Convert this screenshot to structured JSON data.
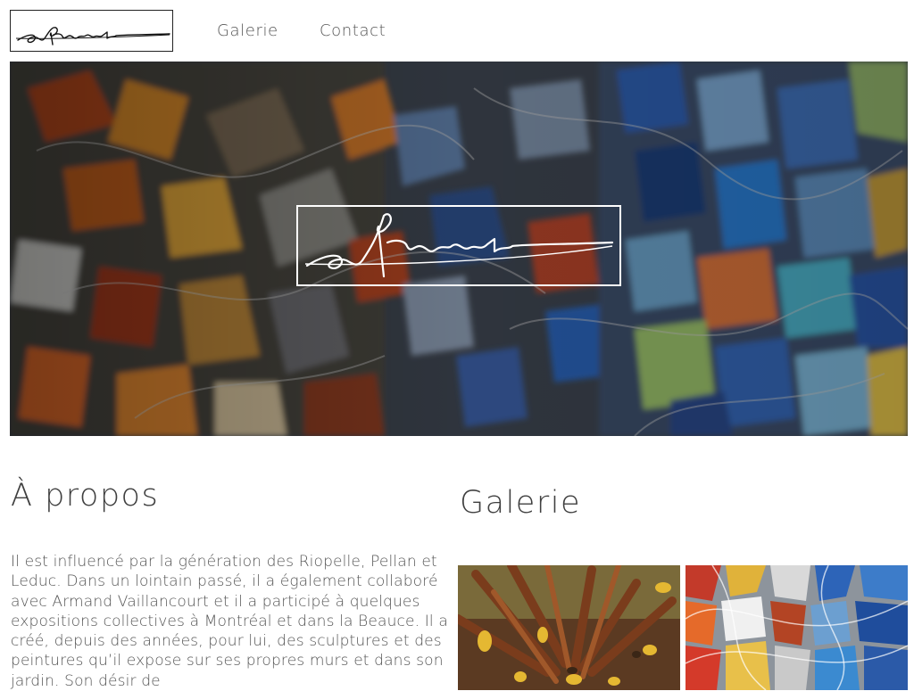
{
  "header": {
    "logo_alt": "Signature logo",
    "nav": [
      {
        "label": "Galerie"
      },
      {
        "label": "Contact"
      }
    ]
  },
  "hero": {
    "logo_alt": "Signature logo"
  },
  "about": {
    "title": "À propos",
    "text": "Il est influencé par la génération des Riopelle, Pellan et Leduc. Dans un lointain passé, il a également collaboré avec Armand Vaillancourt et il a participé à quelques expositions collectives à Montréal et dans la Beauce. Il a créé, depuis des années, pour lui, des sculptures et des peintures qu’il expose sur ses propres murs et dans son jardin. Son désir de"
  },
  "gallery": {
    "title": "Galerie"
  },
  "colors": {
    "text": "#4a4a4a",
    "heading": "#3f3f3f",
    "background": "#ffffff"
  }
}
